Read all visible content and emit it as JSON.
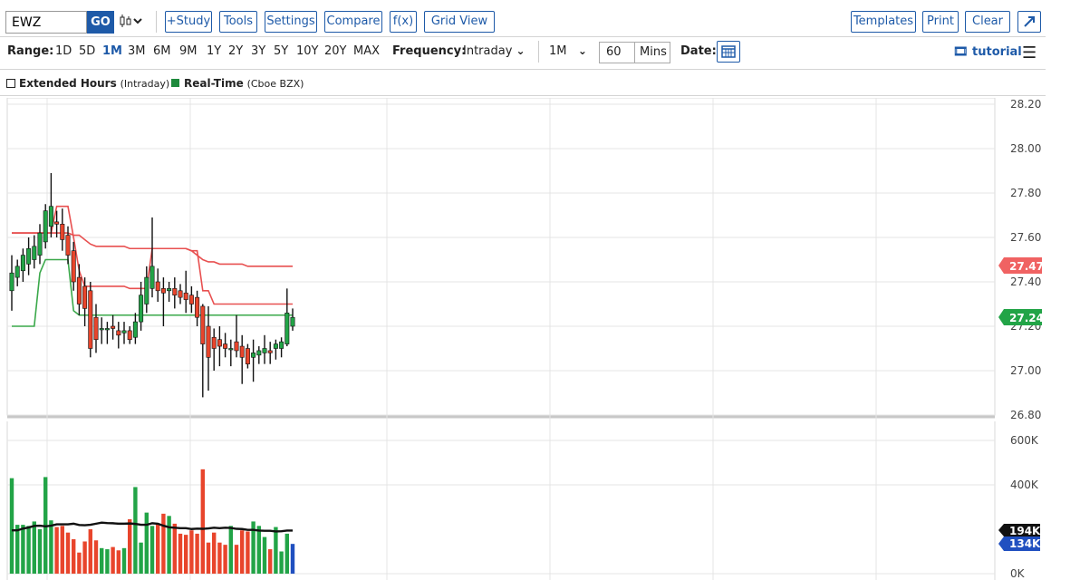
{
  "toolbar": {
    "symbol_value": "EWZ",
    "go_label": "GO",
    "chart_type_icon": "candlestick-icon",
    "study_label": "+Study",
    "tools_label": "Tools",
    "settings_label": "Settings",
    "compare_label": "Compare",
    "fx_label": "f(x)",
    "grid_view_label": "Grid View",
    "templates_label": "Templates",
    "print_label": "Print",
    "clear_label": "Clear",
    "expand_icon": "expand-arrow-icon"
  },
  "range_bar": {
    "range_label": "Range:",
    "ranges": [
      "1D",
      "5D",
      "1M",
      "3M",
      "6M",
      "9M",
      "1Y",
      "2Y",
      "3Y",
      "5Y",
      "10Y",
      "20Y",
      "MAX"
    ],
    "active_range": "1M",
    "frequency_label": "Frequency:",
    "frequency_value": "Intraday",
    "period_value": "1M",
    "interval_value": "60",
    "interval_unit": "Mins",
    "date_label": "Date:",
    "date_icon": "calendar-icon",
    "tutorial_label": "tutorial",
    "tutorial_icon": "film-icon",
    "menu_icon": "hamburger-menu-icon"
  },
  "options_bar": {
    "extended_hours_label": "Extended Hours",
    "extended_hours_note": "(Intraday)",
    "extended_hours_checked": false,
    "realtime_label": "Real-Time",
    "realtime_note": "(Cboe BZX)"
  },
  "colors": {
    "up": "#22a447",
    "down": "#e8452c",
    "band_upper": "#e85050",
    "band_lower": "#3aa84a",
    "accent": "#1e5aa8",
    "volume_avg_label_bg": "#111111",
    "last_volume_label_bg": "#2050c0"
  },
  "price_badges": {
    "upper": "27.47",
    "last": "27.24"
  },
  "volume_badges": {
    "avg": "194K",
    "last": "134K"
  },
  "chart_data": [
    {
      "type": "candlestick",
      "symbol": "EWZ",
      "y_ticks": [
        "28.20",
        "28.00",
        "27.80",
        "27.60",
        "27.40",
        "27.20",
        "27.00",
        "26.80"
      ],
      "ylim": [
        26.8,
        28.2
      ],
      "grid": true,
      "candles": [
        {
          "o": 27.36,
          "h": 27.52,
          "l": 27.27,
          "c": 27.44
        },
        {
          "o": 27.42,
          "h": 27.5,
          "l": 27.38,
          "c": 27.47
        },
        {
          "o": 27.45,
          "h": 27.55,
          "l": 27.4,
          "c": 27.52
        },
        {
          "o": 27.48,
          "h": 27.6,
          "l": 27.43,
          "c": 27.55
        },
        {
          "o": 27.5,
          "h": 27.61,
          "l": 27.46,
          "c": 27.56
        },
        {
          "o": 27.52,
          "h": 27.66,
          "l": 27.48,
          "c": 27.62
        },
        {
          "o": 27.58,
          "h": 27.75,
          "l": 27.55,
          "c": 27.72
        },
        {
          "o": 27.65,
          "h": 27.89,
          "l": 27.6,
          "c": 27.74
        },
        {
          "o": 27.67,
          "h": 27.72,
          "l": 27.6,
          "c": 27.66
        },
        {
          "o": 27.66,
          "h": 27.73,
          "l": 27.54,
          "c": 27.59
        },
        {
          "o": 27.61,
          "h": 27.65,
          "l": 27.48,
          "c": 27.52
        },
        {
          "o": 27.54,
          "h": 27.58,
          "l": 27.36,
          "c": 27.4
        },
        {
          "o": 27.42,
          "h": 27.48,
          "l": 27.25,
          "c": 27.3
        },
        {
          "o": 27.38,
          "h": 27.42,
          "l": 27.2,
          "c": 27.28
        },
        {
          "o": 27.36,
          "h": 27.4,
          "l": 27.06,
          "c": 27.1
        },
        {
          "o": 27.24,
          "h": 27.3,
          "l": 27.08,
          "c": 27.14
        },
        {
          "o": 27.19,
          "h": 27.24,
          "l": 27.12,
          "c": 27.19
        },
        {
          "o": 27.19,
          "h": 27.22,
          "l": 27.12,
          "c": 27.19
        },
        {
          "o": 27.2,
          "h": 27.25,
          "l": 27.14,
          "c": 27.19
        },
        {
          "o": 27.18,
          "h": 27.22,
          "l": 27.1,
          "c": 27.16
        },
        {
          "o": 27.17,
          "h": 27.22,
          "l": 27.12,
          "c": 27.18
        },
        {
          "o": 27.18,
          "h": 27.2,
          "l": 27.12,
          "c": 27.14
        },
        {
          "o": 27.15,
          "h": 27.26,
          "l": 27.12,
          "c": 27.22
        },
        {
          "o": 27.22,
          "h": 27.4,
          "l": 27.18,
          "c": 27.34
        },
        {
          "o": 27.3,
          "h": 27.47,
          "l": 27.26,
          "c": 27.42
        },
        {
          "o": 27.37,
          "h": 27.69,
          "l": 27.33,
          "c": 27.47
        },
        {
          "o": 27.4,
          "h": 27.46,
          "l": 27.31,
          "c": 27.36
        },
        {
          "o": 27.37,
          "h": 27.42,
          "l": 27.2,
          "c": 27.35
        },
        {
          "o": 27.36,
          "h": 27.4,
          "l": 27.31,
          "c": 27.37
        },
        {
          "o": 27.37,
          "h": 27.42,
          "l": 27.28,
          "c": 27.34
        },
        {
          "o": 27.36,
          "h": 27.39,
          "l": 27.3,
          "c": 27.33
        },
        {
          "o": 27.35,
          "h": 27.45,
          "l": 27.26,
          "c": 27.32
        },
        {
          "o": 27.34,
          "h": 27.38,
          "l": 27.26,
          "c": 27.3
        },
        {
          "o": 27.33,
          "h": 27.36,
          "l": 27.2,
          "c": 27.24
        },
        {
          "o": 27.29,
          "h": 27.3,
          "l": 26.88,
          "c": 27.12
        },
        {
          "o": 27.2,
          "h": 27.29,
          "l": 26.91,
          "c": 27.06
        },
        {
          "o": 27.15,
          "h": 27.19,
          "l": 27.0,
          "c": 27.1
        },
        {
          "o": 27.14,
          "h": 27.2,
          "l": 27.02,
          "c": 27.11
        },
        {
          "o": 27.12,
          "h": 27.17,
          "l": 27.06,
          "c": 27.1
        },
        {
          "o": 27.1,
          "h": 27.14,
          "l": 27.02,
          "c": 27.1
        },
        {
          "o": 27.13,
          "h": 27.25,
          "l": 27.06,
          "c": 27.09
        },
        {
          "o": 27.11,
          "h": 27.16,
          "l": 26.94,
          "c": 27.06
        },
        {
          "o": 27.1,
          "h": 27.12,
          "l": 27.01,
          "c": 27.03
        },
        {
          "o": 27.06,
          "h": 27.14,
          "l": 26.95,
          "c": 27.08
        },
        {
          "o": 27.07,
          "h": 27.11,
          "l": 27.03,
          "c": 27.09
        },
        {
          "o": 27.08,
          "h": 27.16,
          "l": 27.03,
          "c": 27.1
        },
        {
          "o": 27.09,
          "h": 27.13,
          "l": 27.03,
          "c": 27.08
        },
        {
          "o": 27.1,
          "h": 27.14,
          "l": 27.05,
          "c": 27.12
        },
        {
          "o": 27.1,
          "h": 27.15,
          "l": 27.06,
          "c": 27.13
        },
        {
          "o": 27.12,
          "h": 27.37,
          "l": 27.11,
          "c": 27.26
        },
        {
          "o": 27.2,
          "h": 27.28,
          "l": 27.18,
          "c": 27.24
        }
      ],
      "upper_band": [
        27.62,
        27.62,
        27.62,
        27.62,
        27.62,
        27.62,
        27.62,
        27.62,
        27.74,
        27.74,
        27.74,
        27.6,
        27.45,
        27.38,
        27.38,
        27.38,
        27.38,
        27.38,
        27.38,
        27.38,
        27.38,
        27.37,
        27.37,
        27.37,
        27.37,
        27.55,
        27.55,
        27.55,
        27.55,
        27.55,
        27.55,
        27.55,
        27.54,
        27.54,
        27.36,
        27.36,
        27.3,
        27.3,
        27.3,
        27.3,
        27.3,
        27.3,
        27.3,
        27.3,
        27.3,
        27.3,
        27.3,
        27.3,
        27.3,
        27.3,
        27.3
      ],
      "mid_band": [
        27.62,
        27.62,
        27.62,
        27.62,
        27.62,
        27.62,
        27.62,
        27.62,
        27.62,
        27.62,
        27.62,
        27.61,
        27.61,
        27.59,
        27.57,
        27.56,
        27.56,
        27.56,
        27.56,
        27.56,
        27.56,
        27.55,
        27.55,
        27.55,
        27.55,
        27.55,
        27.55,
        27.55,
        27.55,
        27.55,
        27.55,
        27.55,
        27.54,
        27.52,
        27.5,
        27.49,
        27.49,
        27.48,
        27.48,
        27.48,
        27.48,
        27.48,
        27.47,
        27.47,
        27.47,
        27.47,
        27.47,
        27.47,
        27.47,
        27.47,
        27.47
      ],
      "lower_band": [
        27.2,
        27.2,
        27.2,
        27.2,
        27.2,
        27.44,
        27.5,
        27.5,
        27.5,
        27.5,
        27.5,
        27.27,
        27.25,
        27.25,
        27.25,
        27.25,
        27.25,
        27.25,
        27.25,
        27.25,
        27.25,
        27.25,
        27.25,
        27.25,
        27.25,
        27.25,
        27.25,
        27.25,
        27.25,
        27.25,
        27.25,
        27.25,
        27.25,
        27.25,
        27.25,
        27.25,
        27.25,
        27.25,
        27.25,
        27.25,
        27.25,
        27.25,
        27.25,
        27.25,
        27.25,
        27.25,
        27.25,
        27.25,
        27.25,
        27.25,
        27.25
      ]
    },
    {
      "type": "bar",
      "y_ticks": [
        "600K",
        "400K",
        "0K"
      ],
      "ylim": [
        0,
        600
      ],
      "volume": [
        430,
        220,
        220,
        215,
        235,
        200,
        435,
        240,
        210,
        215,
        185,
        155,
        95,
        145,
        200,
        150,
        115,
        110,
        120,
        105,
        115,
        245,
        390,
        140,
        275,
        215,
        225,
        270,
        260,
        225,
        180,
        175,
        195,
        180,
        470,
        140,
        185,
        140,
        130,
        215,
        130,
        195,
        190,
        235,
        215,
        165,
        110,
        210,
        100,
        180,
        134
      ],
      "volume_avg": [
        195,
        195,
        203,
        208,
        215,
        216,
        213,
        216,
        222,
        222,
        222,
        225,
        219,
        218,
        220,
        225,
        230,
        228,
        227,
        225,
        225,
        226,
        224,
        220,
        220,
        227,
        225,
        216,
        209,
        207,
        205,
        205,
        201,
        203,
        202,
        204,
        207,
        205,
        207,
        206,
        202,
        201,
        197,
        197,
        194,
        193,
        193,
        190,
        191,
        194,
        194
      ]
    }
  ]
}
